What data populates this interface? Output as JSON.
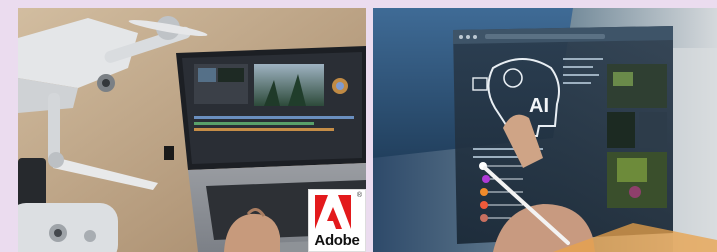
{
  "left_photo": {
    "brand_badge": {
      "wordmark": "Adobe",
      "registered_mark": "®",
      "color": "#e31a1c"
    }
  },
  "right_photo": {
    "overlay_text": "AI",
    "dot_colors": [
      "#ffffff",
      "#b03ad8",
      "#f08a2a",
      "#f05a3a",
      "#c87060"
    ]
  }
}
